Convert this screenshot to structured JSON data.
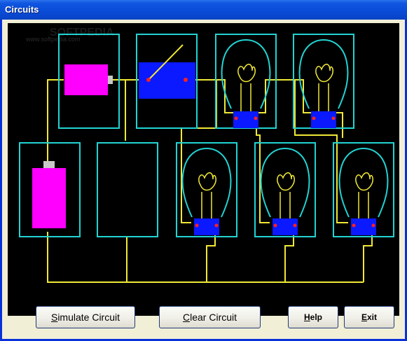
{
  "window": {
    "title": "Circuits"
  },
  "watermark": {
    "text": "SOFTPEDIA",
    "url": "www.softpedia.com"
  },
  "buttons": {
    "simulate": {
      "mnemonic": "S",
      "rest": "imulate Circuit"
    },
    "clear": {
      "mnemonic": "C",
      "rest": "lear Circuit"
    },
    "help": {
      "mnemonic": "H",
      "rest": "elp"
    },
    "exit": {
      "mnemonic": "E",
      "rest": "xit"
    }
  },
  "colors": {
    "canvas": "#000000",
    "slot_border": "#22d3d3",
    "wire": "#f0e836",
    "battery": "#ff00ff",
    "switch": "#0a19ff",
    "bulb_base": "#0a19ff",
    "terminal": "#ff2020"
  },
  "components": {
    "battery_horizontal": "battery-icon",
    "switch": "knife-switch-icon",
    "bulbs": [
      "light-bulb-icon",
      "light-bulb-icon",
      "light-bulb-icon",
      "light-bulb-icon",
      "light-bulb-icon"
    ],
    "battery_vertical": "battery-icon",
    "empty_slot": "empty-slot"
  }
}
